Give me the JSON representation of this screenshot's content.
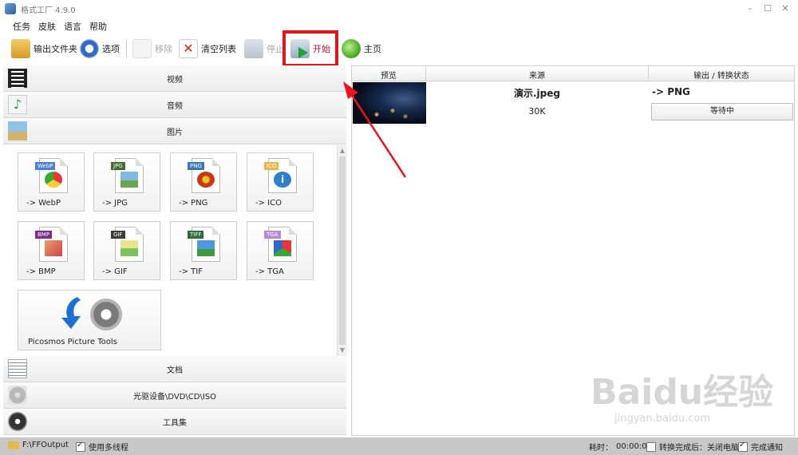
{
  "app": {
    "title": "格式工厂 4.9.0"
  },
  "window_controls": {
    "minimize": "–",
    "maximize": "☐",
    "close": "✕"
  },
  "menu": [
    "任务",
    "皮肤",
    "语言",
    "帮助"
  ],
  "toolbar": {
    "output_folder": "输出文件夹",
    "options": "选项",
    "remove": "移除",
    "clear_list": "清空列表",
    "stop": "停止",
    "start": "开始",
    "home": "主页"
  },
  "categories": {
    "video": "视频",
    "audio": "音频",
    "image": "图片",
    "document": "文档",
    "optical": "光驱设备\\DVD\\CD\\ISO",
    "tools": "工具集"
  },
  "image_formats": [
    {
      "tag": "WebP",
      "label": "-> WebP",
      "tag_color": "#4a7fe0"
    },
    {
      "tag": "JPG",
      "label": "-> JPG",
      "tag_color": "#3e6d2e"
    },
    {
      "tag": "PNG",
      "label": "-> PNG",
      "tag_color": "#3b78b8"
    },
    {
      "tag": "ICO",
      "label": "-> ICO",
      "tag_color": "#e6b84a"
    },
    {
      "tag": "BMP",
      "label": "-> BMP",
      "tag_color": "#7a2d8c"
    },
    {
      "tag": "GIF",
      "label": "-> GIF",
      "tag_color": "#3c3c3c"
    },
    {
      "tag": "TIFF",
      "label": "-> TIF",
      "tag_color": "#2c6e3b"
    },
    {
      "tag": "TGA",
      "label": "-> TGA",
      "tag_color": "#b58ad6"
    }
  ],
  "picosmos": {
    "label": "Picosmos Picture Tools"
  },
  "table": {
    "headers": {
      "preview": "预览",
      "source": "来源",
      "output": "输出 / 转换状态"
    },
    "rows": [
      {
        "name": "演示.jpeg",
        "size": "30K",
        "format": "-> PNG",
        "status": "等待中"
      }
    ]
  },
  "statusbar": {
    "folder": "F:\\FFOutput",
    "multithread": "使用多线程",
    "elapsed_label": "耗时：",
    "elapsed_value": "00:00:00",
    "after_convert": "转换完成后：关闭电脑",
    "notify": "完成通知"
  },
  "watermark": {
    "main": "Baidu经验",
    "sub": "jingyan.baidu.com"
  },
  "colors": {
    "highlight": "#e8141c",
    "statusbar": "#c8c8c8"
  }
}
